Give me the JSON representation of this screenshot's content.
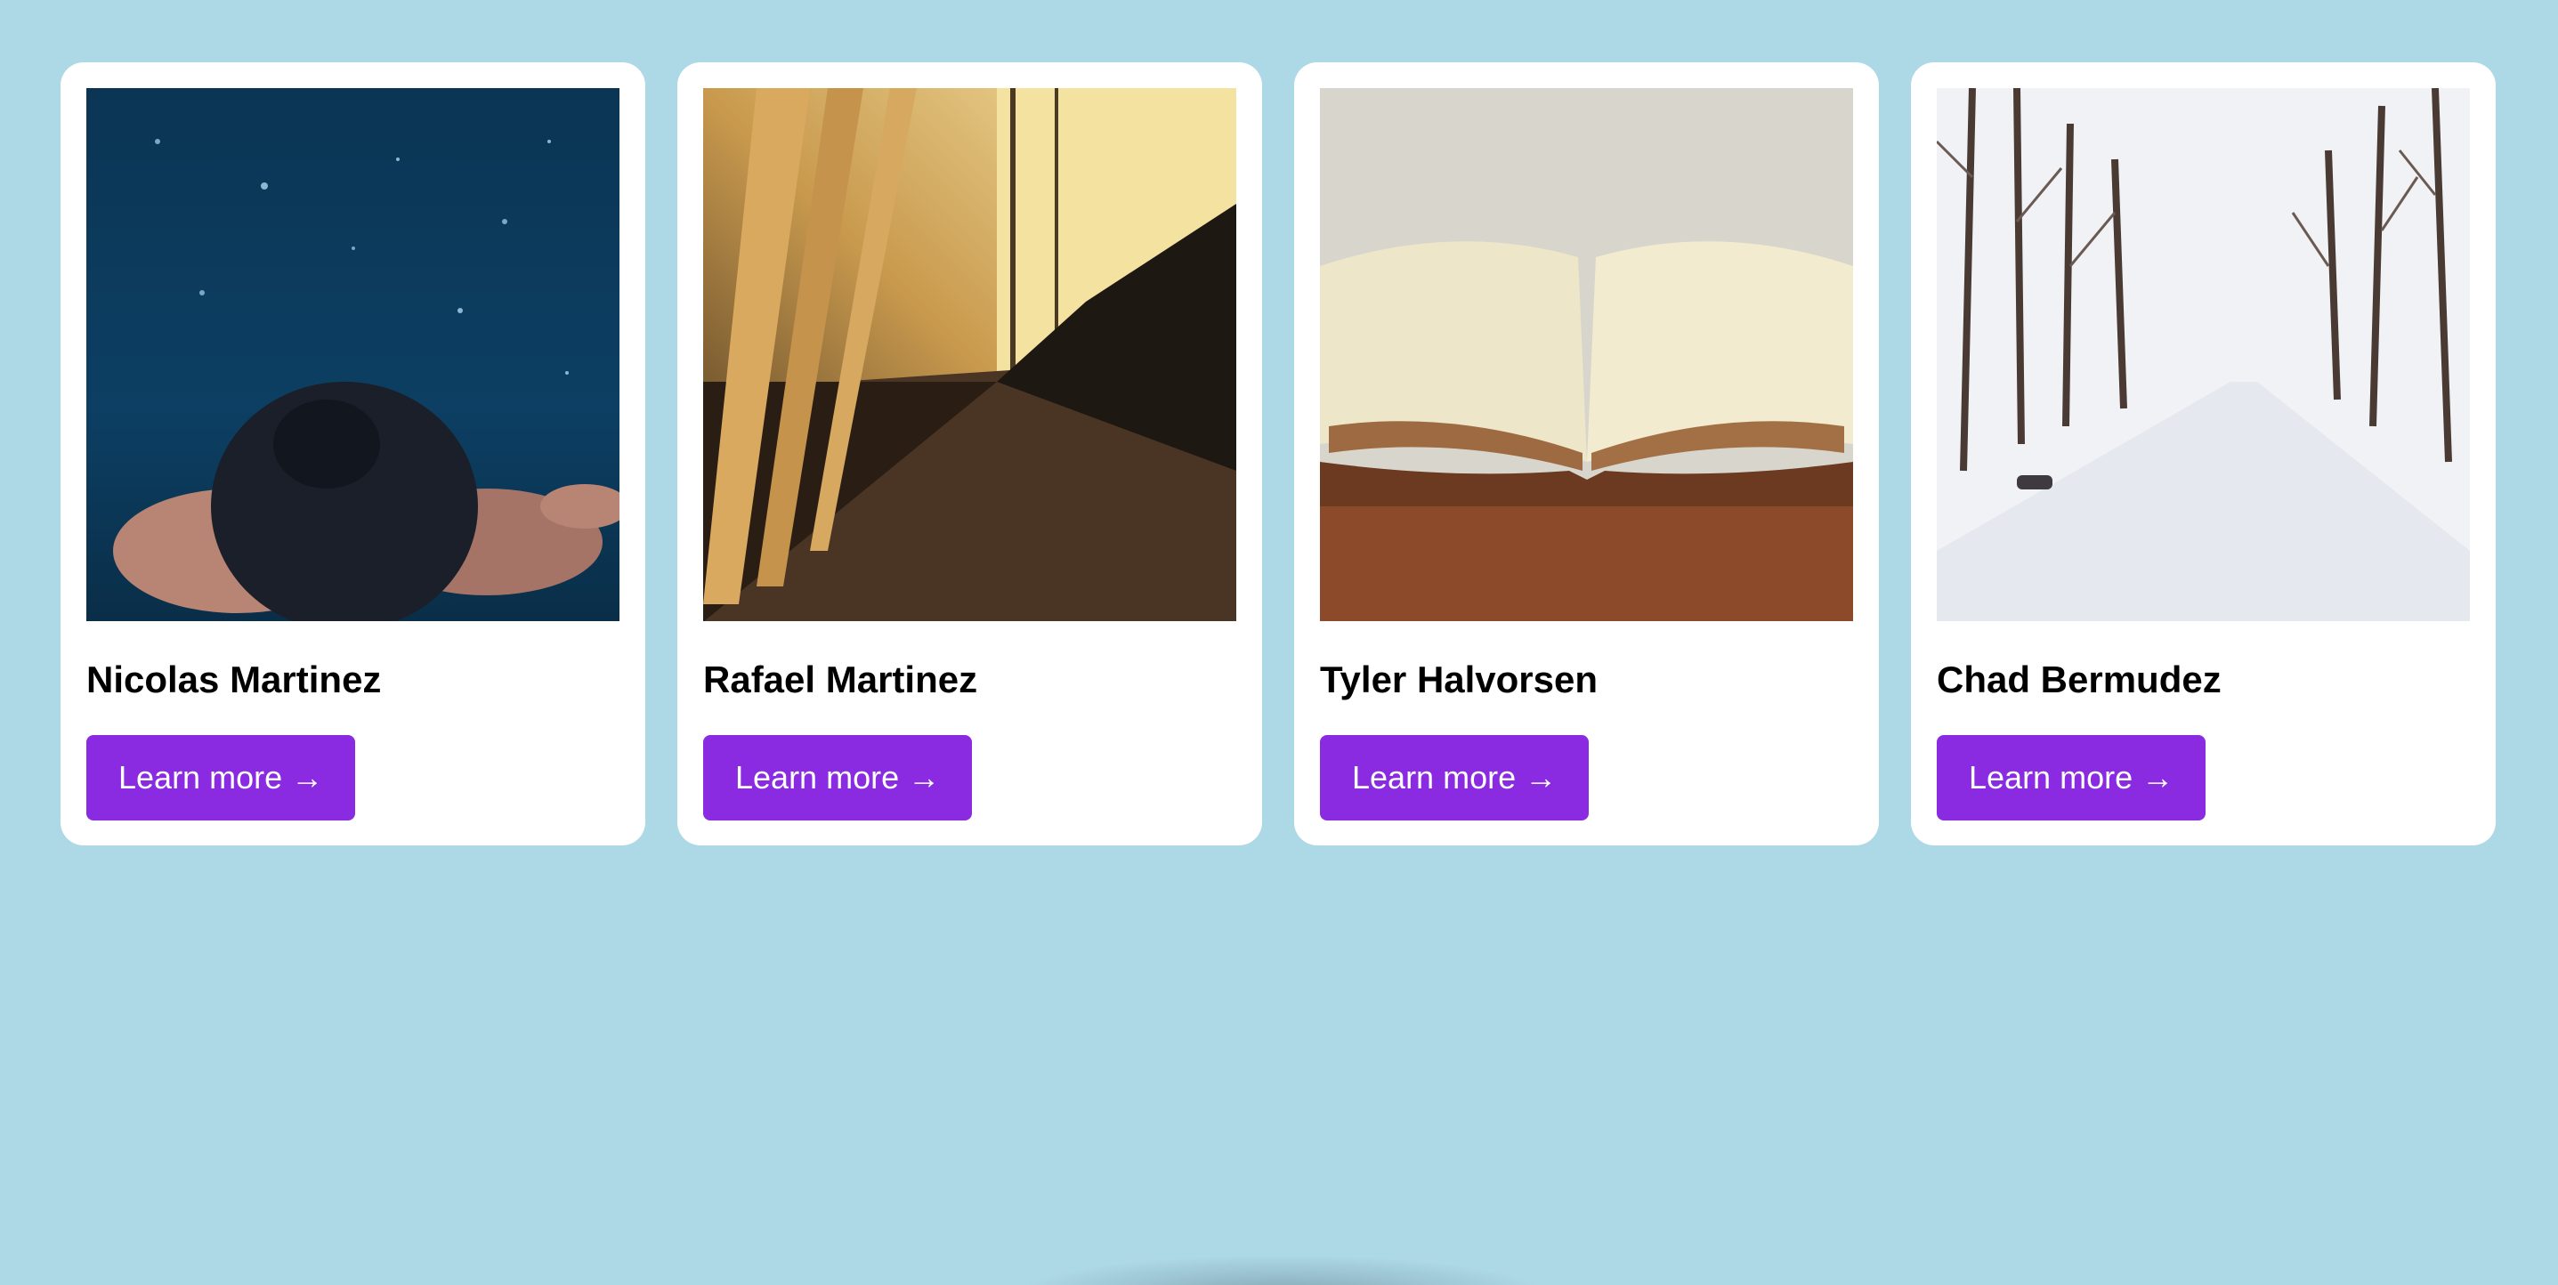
{
  "colors": {
    "background": "#add8e6",
    "card": "#ffffff",
    "button": "#8a2be2",
    "button_text": "#ffffff"
  },
  "cards": [
    {
      "name": "Nicolas Martinez",
      "button_label": "Learn more →",
      "image": "underwater-swimmer-photo"
    },
    {
      "name": "Rafael Martinez",
      "button_label": "Learn more →",
      "image": "piano-keys-photo"
    },
    {
      "name": "Tyler Halvorsen",
      "button_label": "Learn more →",
      "image": "open-book-photo"
    },
    {
      "name": "Chad Bermudez",
      "button_label": "Learn more →",
      "image": "snowy-road-photo"
    }
  ]
}
